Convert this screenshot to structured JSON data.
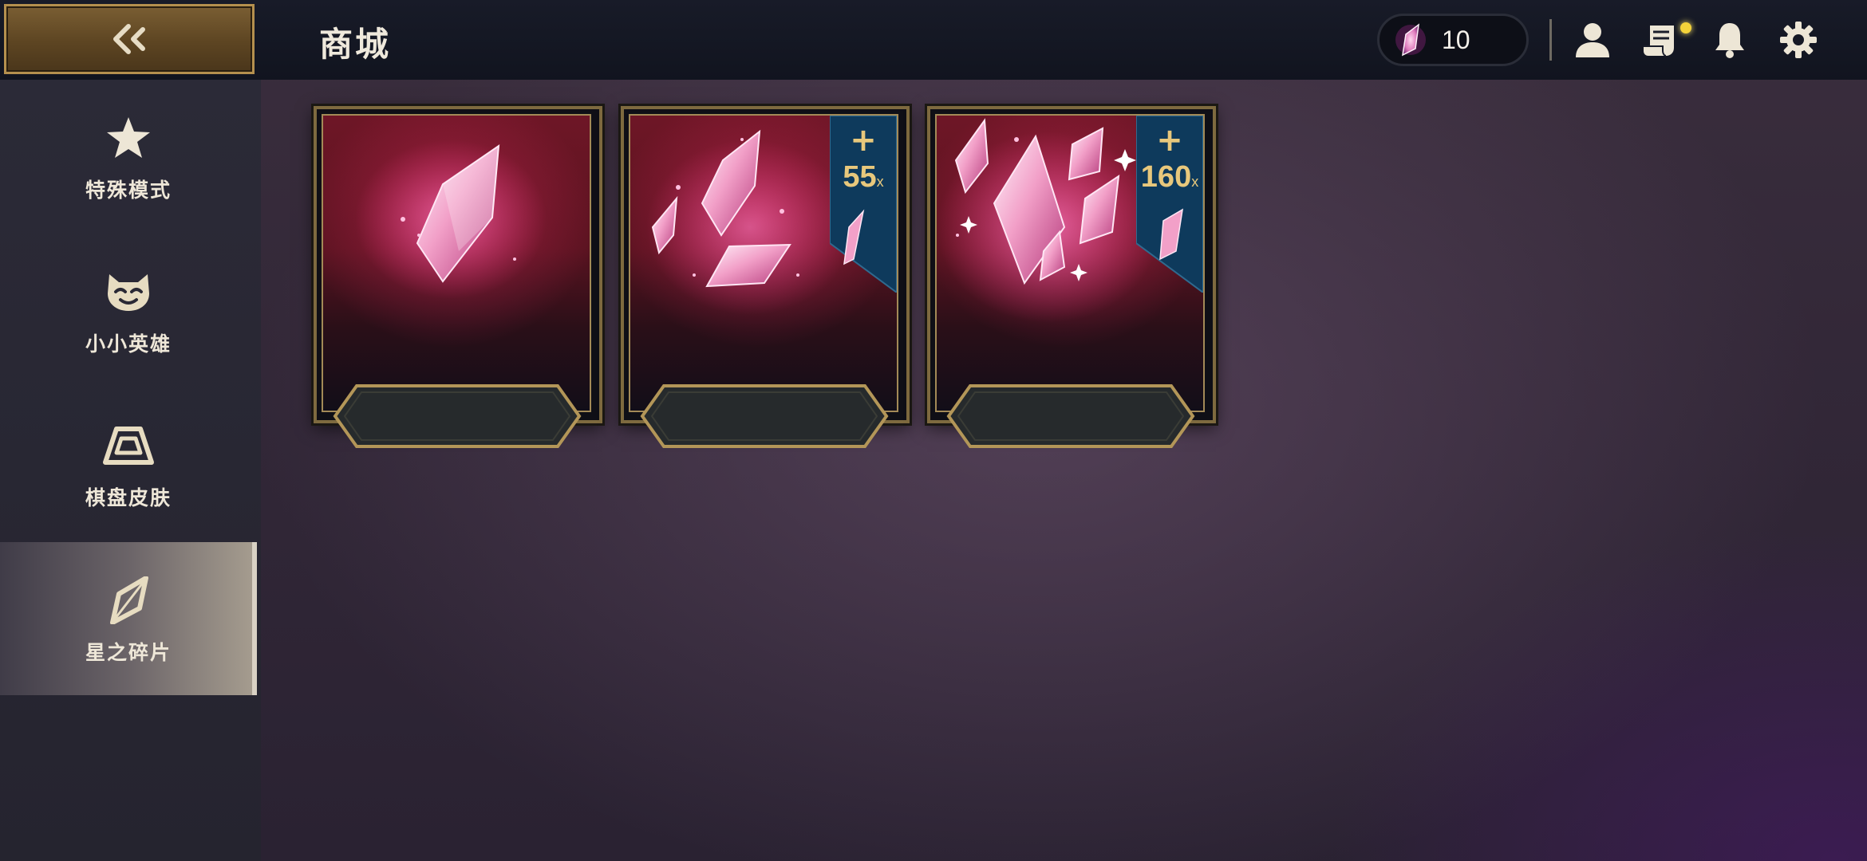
{
  "header": {
    "back_icon": "double-chevron-left-icon",
    "title": "商城",
    "currency": {
      "icon": "star-shard-gem-icon",
      "amount": "10"
    },
    "icons": [
      "profile-icon",
      "scroll-icon",
      "bell-icon",
      "gear-icon"
    ],
    "scroll_has_notification": true
  },
  "sidebar": {
    "items": [
      {
        "label": "特殊模式",
        "icon": "star-icon",
        "active": false
      },
      {
        "label": "小小英雄",
        "icon": "little-legend-face-icon",
        "active": false
      },
      {
        "label": "棋盘皮肤",
        "icon": "arena-trapezoid-icon",
        "active": false
      },
      {
        "label": "星之碎片",
        "icon": "star-shard-icon",
        "active": true
      }
    ]
  },
  "shop": {
    "cards": [
      {
        "art": "single-star-shard",
        "bonus": null,
        "price_label": ""
      },
      {
        "art": "multiple-star-shards",
        "bonus": {
          "plus": "+",
          "amount": "55",
          "suffix": "x"
        },
        "price_label": ""
      },
      {
        "art": "many-star-shards",
        "bonus": {
          "plus": "+",
          "amount": "160",
          "suffix": "x"
        },
        "price_label": ""
      }
    ]
  },
  "colors": {
    "accent_gold": "#b5904e",
    "bonus_text": "#e8c87c",
    "ribbon_blue": "#0e3a5c",
    "shard_pink": "#f2a0c8"
  }
}
